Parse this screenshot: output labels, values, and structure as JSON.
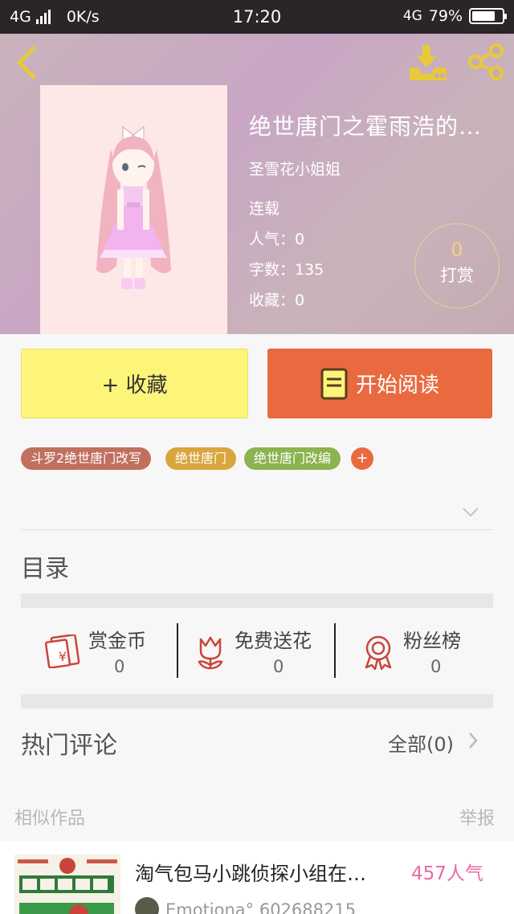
{
  "status_bar": {
    "network_left": "4G",
    "speed": "0K/s",
    "time": "17:20",
    "network_right": "4G",
    "battery": "79%",
    "battery_level": 0.79
  },
  "book": {
    "title": "绝世唐门之霍雨浩的…",
    "author": "圣雪花小姐姐",
    "status": "连载",
    "popularity": "人气：0",
    "word_count": "字数：135",
    "favorites": "收藏：0"
  },
  "tip": {
    "count": "0",
    "label": "打赏"
  },
  "actions": {
    "collect_label": "+ 收藏",
    "read_label": "开始阅读"
  },
  "tags": [
    {
      "label": "斗罗2绝世唐门改写",
      "color": "#c0705e"
    },
    {
      "label": "绝世唐门",
      "color": "#d9a63e"
    },
    {
      "label": "绝世唐门改编",
      "color": "#8bb34f"
    }
  ],
  "tag_add": "+",
  "toc": {
    "title": "目录"
  },
  "stats": [
    {
      "label": "赏金币",
      "value": "0",
      "icon": "red-envelope-icon"
    },
    {
      "label": "免费送花",
      "value": "0",
      "icon": "flower-icon"
    },
    {
      "label": "粉丝榜",
      "value": "0",
      "icon": "ribbon-medal-icon"
    }
  ],
  "comments": {
    "title": "热门评论",
    "all_label": "全部(0)"
  },
  "similar": {
    "title": "相似作品",
    "report": "举报",
    "items": [
      {
        "title": "淘气包马小跳侦探小组在…",
        "popularity": "457人气",
        "author": "Emotiona° 602688215"
      }
    ]
  },
  "colors": {
    "accent_orange": "#ea6a40",
    "collect_yellow": "#fdf47a",
    "icon_gold": "#e8c93a",
    "icon_red": "#c9453a",
    "popularity_pink": "#e86aa6"
  }
}
